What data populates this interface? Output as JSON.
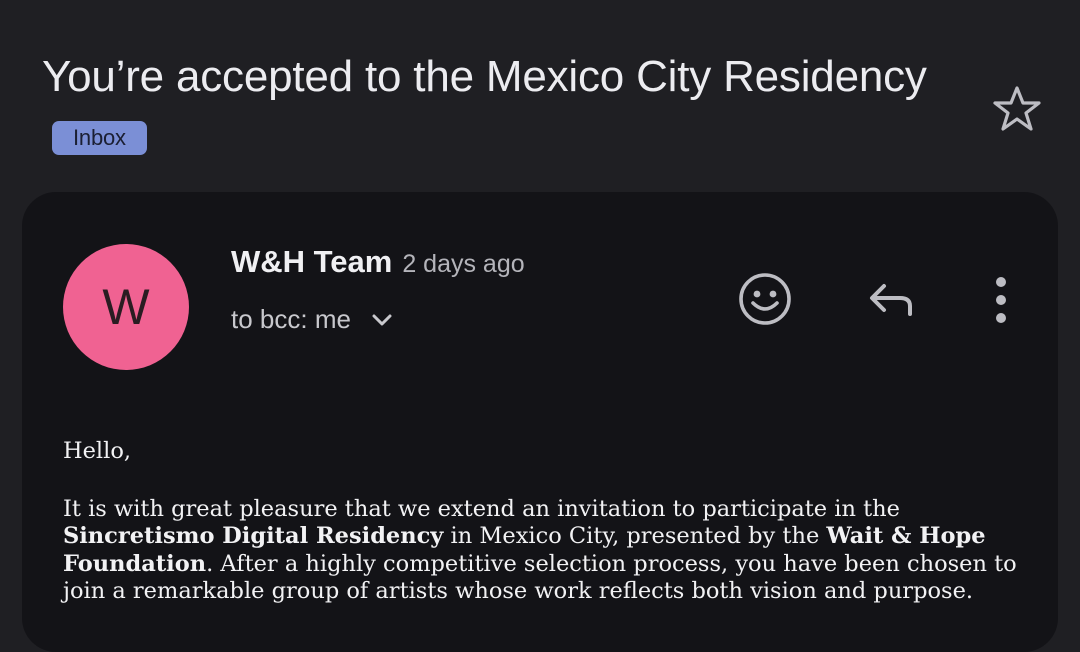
{
  "email": {
    "subject": "You’re accepted to the Mexico City Residency",
    "label": "Inbox",
    "sender": {
      "initial": "W",
      "name": "W&H Team",
      "time": "2 days ago",
      "recipient": "to bcc: me"
    },
    "body": {
      "greeting": "Hello,",
      "paragraph": [
        "It is with great pleasure that we extend an invitation to participate in the ",
        "Sincretismo Digital Residency",
        " in Mexico City, presented by the ",
        "Wait & Hope Foundation",
        ". After a highly competitive selection process, you have been chosen to join a remarkable group of artists whose work reflects both vision and purpose."
      ]
    }
  },
  "icons": {
    "star": "star-outline-icon",
    "emoji": "add-reaction-icon",
    "reply": "reply-icon",
    "more": "more-vertical-icon",
    "chevron": "chevron-down-icon"
  },
  "colors": {
    "background": "#1f1f23",
    "card": "#131317",
    "label_chip": "#7b8fd6",
    "avatar": "#f06292",
    "icon": "#bdbdc3"
  }
}
